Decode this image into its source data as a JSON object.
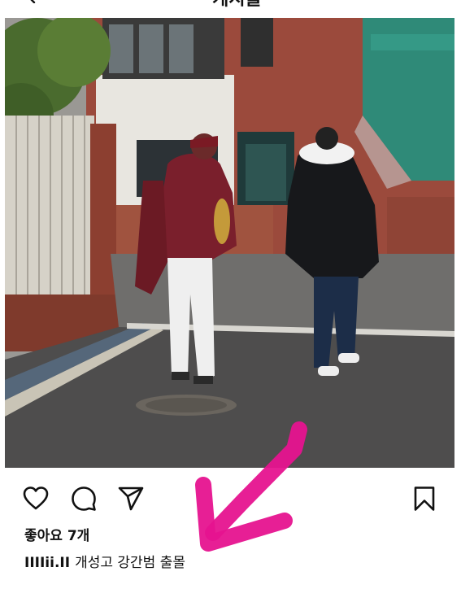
{
  "header": {
    "title": "게시물",
    "back_icon": "back-arrow-icon"
  },
  "post": {
    "photo_description_icon": "photo",
    "likes_text": "좋아요 7개",
    "caption": {
      "username": "IIIIii.II",
      "text": "개성고 강간범 출몰"
    }
  },
  "actions": {
    "like_icon": "heart-icon",
    "comment_icon": "comment-bubble-icon",
    "share_icon": "paper-plane-icon",
    "save_icon": "bookmark-icon"
  },
  "colors": {
    "annotation": "#e6138f",
    "text": "#111111",
    "background": "#ffffff"
  }
}
